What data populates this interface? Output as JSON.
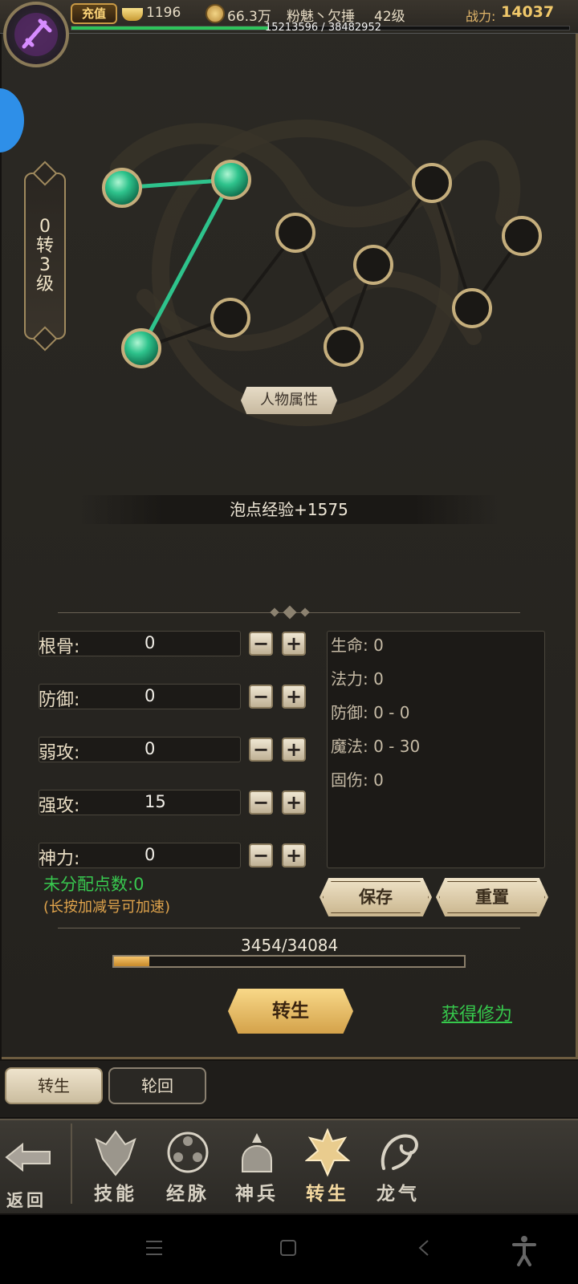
{
  "topbar": {
    "recharge_label": "充值",
    "ingot_count": "1196",
    "coins": "66.3万",
    "player_name": "粉魅丶欠捶",
    "level": "42级",
    "power_label": "战力:",
    "power_value": "14037",
    "exp_text": "15213596 / 38482952",
    "exp_progress": 0.395
  },
  "rebirth_rank": [
    "0",
    "转",
    "3",
    "级"
  ],
  "attr_button": "人物属性",
  "bubble_text": "泡点经验+1575",
  "stats": [
    {
      "label": "根骨:",
      "value": "0"
    },
    {
      "label": "防御:",
      "value": "0"
    },
    {
      "label": "弱攻:",
      "value": "0"
    },
    {
      "label": "强攻:",
      "value": "15"
    },
    {
      "label": "神力:",
      "value": "0"
    }
  ],
  "info_lines": [
    "生命: 0",
    "法力: 0",
    "防御: 0 - 0",
    "魔法: 0 - 30",
    "固伤: 0"
  ],
  "unallocated": "未分配点数:0",
  "hint": "(长按加减号可加速)",
  "save_label": "保存",
  "reset_label": "重置",
  "progress_text": "3454/34084",
  "progress_value": 0.101,
  "rebirth_label": "转生",
  "gain_link": "获得修为",
  "tabs": {
    "active": "转生",
    "inactive": "轮回"
  },
  "nav": {
    "back": "返回",
    "items": [
      "技能",
      "经脉",
      "神兵",
      "转生",
      "龙气"
    ]
  },
  "colors": {
    "active_node": "#2ec38c",
    "accent_gold": "#f0c86a",
    "link_green": "#36c84c"
  }
}
